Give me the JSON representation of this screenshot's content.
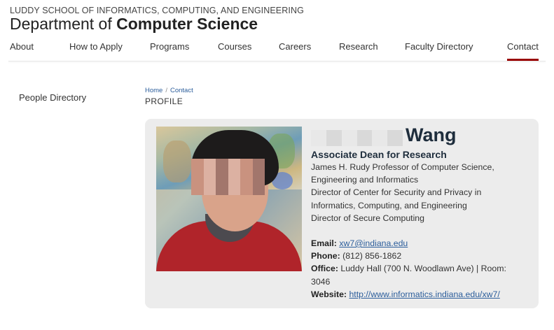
{
  "header": {
    "school": "LUDDY SCHOOL OF INFORMATICS, COMPUTING, AND ENGINEERING",
    "dept_prefix": "Department of ",
    "dept_bold": "Computer Science"
  },
  "nav": {
    "items": [
      "About",
      "How to Apply",
      "Programs",
      "Courses",
      "Careers",
      "Research",
      "Faculty Directory",
      "Contact"
    ],
    "active": "Contact",
    "accent": "#990000"
  },
  "sidebar": {
    "link": "People Directory"
  },
  "breadcrumb": {
    "home": "Home",
    "sep": "/",
    "current": "Contact"
  },
  "page": {
    "label": "PROFILE"
  },
  "profile": {
    "last_name": "Wang",
    "position": "Associate Dean for Research",
    "titles": [
      "James H. Rudy Professor of Computer Science,",
      "Engineering and Informatics",
      "Director of Center for Security and Privacy in",
      "Informatics, Computing, and Engineering",
      "Director of Secure Computing"
    ],
    "email_label": "Email:",
    "email": "xw7@indiana.edu",
    "phone_label": "Phone:",
    "phone": "(812) 856-1862",
    "office_label": "Office:",
    "office": "Luddy Hall (700 N. Woodlawn Ave) | Room:",
    "office_room": "3046",
    "website_label": "Website:",
    "website": "http://www.informatics.indiana.edu/xw7/"
  }
}
